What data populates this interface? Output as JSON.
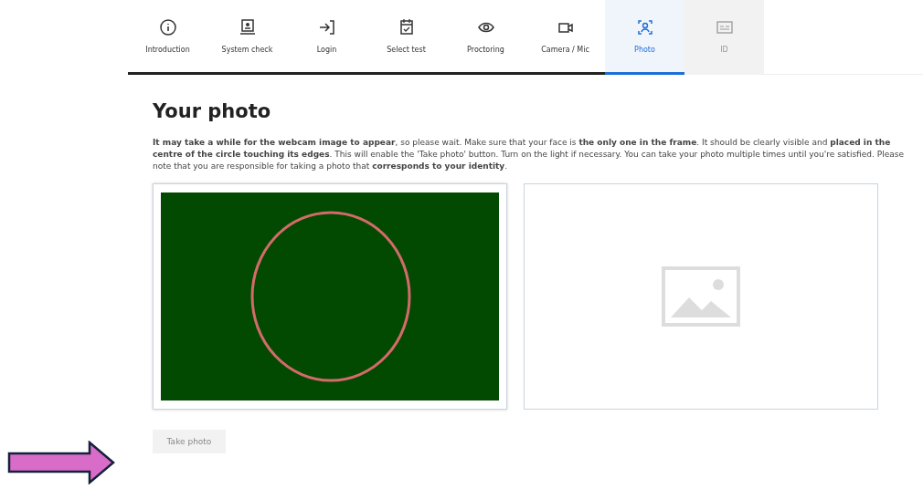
{
  "steps": [
    {
      "label": "Introduction",
      "selected": false,
      "completed": true,
      "disabled": false
    },
    {
      "label": "System check",
      "selected": false,
      "completed": true,
      "disabled": false
    },
    {
      "label": "Login",
      "selected": false,
      "completed": true,
      "disabled": false
    },
    {
      "label": "Select test",
      "selected": false,
      "completed": true,
      "disabled": false
    },
    {
      "label": "Proctoring",
      "selected": false,
      "completed": true,
      "disabled": false
    },
    {
      "label": "Camera / Mic",
      "selected": false,
      "completed": true,
      "disabled": false
    },
    {
      "label": "Photo",
      "selected": true,
      "completed": false,
      "disabled": false
    },
    {
      "label": "ID",
      "selected": false,
      "completed": false,
      "disabled": true
    }
  ],
  "heading": "Your photo",
  "instructions": "**It may take a while for the webcam image to appear**, so please wait. Make sure that your face is **the only one in the frame**. It should be clearly visible and **placed in the centre of the circle touching its edges**. This will enable the 'Take photo' button. Turn on the light if necessary. You can take your photo multiple times until you're satisfied. Please note that you are responsible for taking a photo that **corresponds to your identity**.",
  "take_photo_button": {
    "label": "Take photo",
    "disabled": true
  }
}
